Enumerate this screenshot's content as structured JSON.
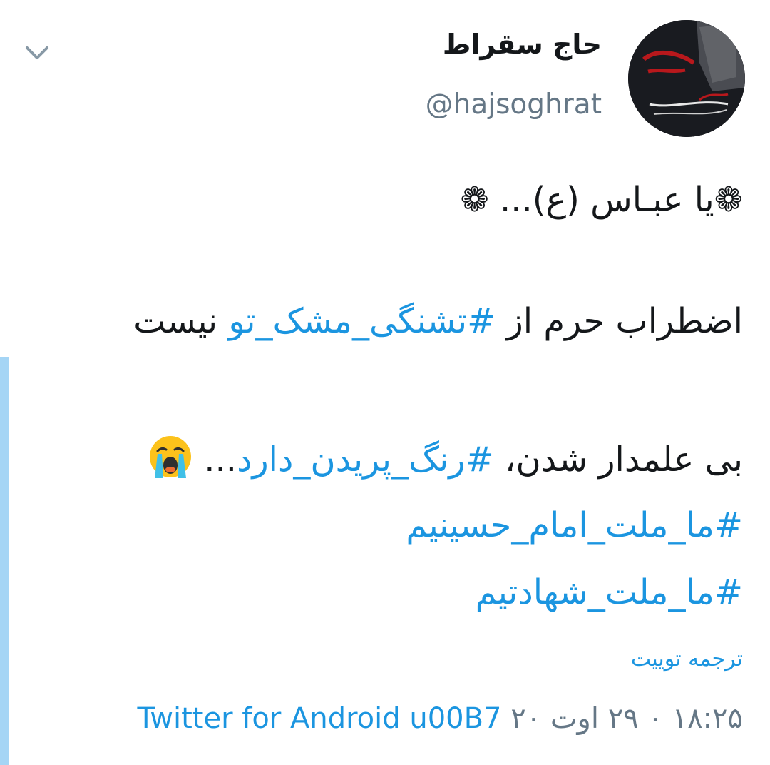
{
  "tweet": {
    "author_name": "حاج سقراط",
    "handle": "@hajsoghrat",
    "line1": "❁یا عبـاس (ع)... ❁",
    "line2_pre": "اضطراب حرم از ",
    "line2_tag": "#تشنگی_مشک_تو",
    "line2_post": " نیست",
    "line3_pre": "بی علمدار شدن، ",
    "line3_tag": "#رنگ_پریدن_دارد",
    "line3_post": "...",
    "hashtag1": "#ما_ملت_امام_حسینیم",
    "hashtag2": "#ما_ملت_شهادتیم",
    "translate_label": "ترجمه توییت",
    "timestamp": "۱۸:۲۵ ۰ ۲۹ اوت ۲۰",
    "source": "Twitter for Android u00B7",
    "emoji": "loudly-crying-face-icon"
  },
  "colors": {
    "link": "#1b95e0",
    "muted": "#657786",
    "text": "#14171a",
    "thread_line": "#a5d5f5"
  },
  "icons": {
    "menu": "chevron-down-icon"
  }
}
